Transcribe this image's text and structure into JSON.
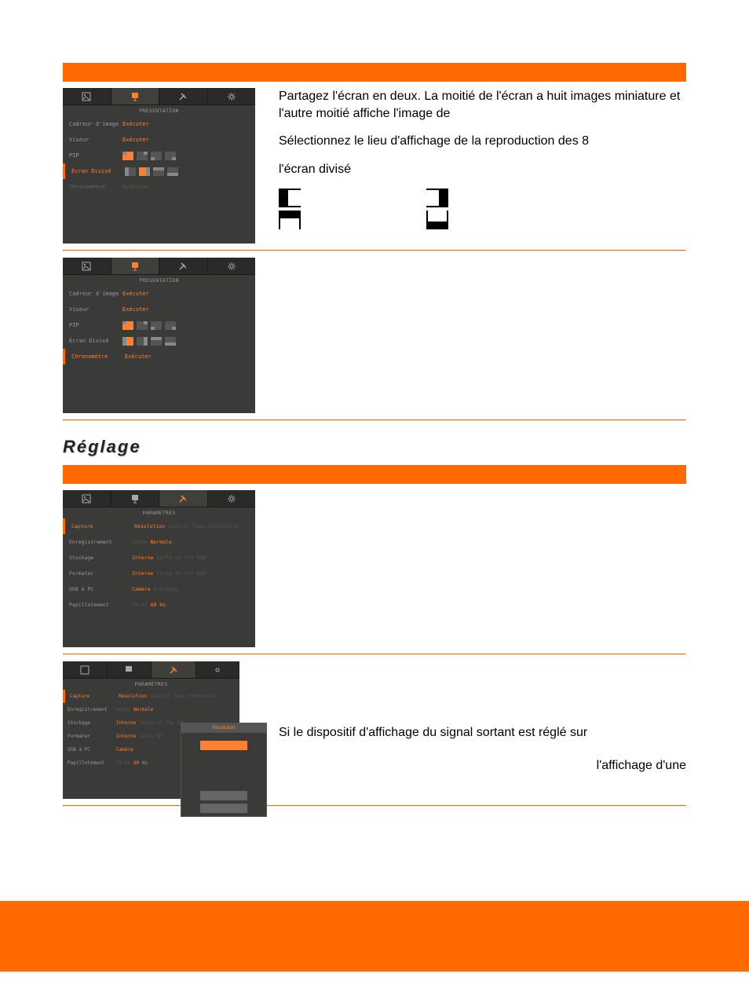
{
  "section1": {
    "screenshotA": {
      "title": "PRESENTATION",
      "rows": [
        {
          "label": "Cadreur d'image",
          "value": "Exécuter",
          "type": "text"
        },
        {
          "label": "Viseur",
          "value": "Exécuter",
          "type": "text"
        },
        {
          "label": "PIP",
          "type": "pip",
          "selected": 0
        },
        {
          "label": "Ecran Divisé",
          "type": "split",
          "selected": 1,
          "highlight": true
        },
        {
          "label": "Chronomètre",
          "value": "Exécuter",
          "type": "text",
          "dim": true
        }
      ]
    },
    "desc": {
      "p1": "Partagez l'écran en deux. La moitié de l'écran a huit images miniature et l'autre moitié affiche l'image de",
      "p2": "Sélectionnez le lieu d'affichage de la reproduction des 8",
      "p3": "l'écran divisé"
    },
    "screenshotB": {
      "title": "PRESENTATION",
      "rows": [
        {
          "label": "Cadreur d'image",
          "value": "Exécuter",
          "type": "text"
        },
        {
          "label": "Viseur",
          "value": "Exécuter",
          "type": "text"
        },
        {
          "label": "PIP",
          "type": "pip",
          "selected": 0
        },
        {
          "label": "Ecran Divisé",
          "type": "split",
          "selected": 0
        },
        {
          "label": "Chronomètre",
          "value": "Exécuter",
          "type": "text",
          "highlight": true
        }
      ]
    }
  },
  "heading": "Réglage",
  "section2": {
    "screenshotC": {
      "title": "PARAMETRES",
      "rows": [
        {
          "label": "Capture",
          "opts": [
            "Résolution",
            "Quality",
            "Type",
            "Intervalle"
          ],
          "on": 0,
          "highlight": true
        },
        {
          "label": "Enregistrement",
          "opts": [
            "Haute",
            "Normale"
          ],
          "on": 1
        },
        {
          "label": "Stockage",
          "opts": [
            "Interne",
            "Carte SD",
            "Clé USB"
          ],
          "on": 0
        },
        {
          "label": "Formater",
          "opts": [
            "Interne",
            "Carte SD",
            "Clé USB"
          ],
          "on": 0
        },
        {
          "label": "USB à PC",
          "opts": [
            "Caméra",
            "Stockage"
          ],
          "on": 0
        },
        {
          "label": "Papillotement",
          "opts": [
            "50 Hz",
            "60 Hz"
          ],
          "on": 1
        }
      ]
    },
    "screenshotD": {
      "title": "PARAMETRES",
      "rows": [
        {
          "label": "Capture",
          "opts": [
            "Résolution",
            "Quality",
            "Type",
            "Intervalle"
          ],
          "on": 0,
          "highlight": true
        },
        {
          "label": "Enregistrement",
          "opts": [
            "Haute",
            "Normale"
          ],
          "on": 1
        },
        {
          "label": "Stockage",
          "opts": [
            "Interne",
            "Carte SD",
            "Clé USB"
          ],
          "on": 0
        },
        {
          "label": "Formater",
          "opts": [
            "Interne",
            "Carte SD"
          ],
          "on": 0
        },
        {
          "label": "USB à PC",
          "opts": [
            "Caméra"
          ],
          "on": 0
        },
        {
          "label": "Papillotement",
          "opts": [
            "50 Hz",
            "60 Hz"
          ],
          "on": 1
        }
      ],
      "dialog": {
        "title": "Résolution",
        "btn": ""
      }
    },
    "desc": {
      "p1": "Si le dispositif d'affichage du signal sortant est réglé sur",
      "p2": "l'affichage d'une"
    }
  },
  "icons": {
    "image": "image-icon",
    "presentation": "presentation-icon",
    "tools": "tools-icon",
    "settings": "settings-icon"
  }
}
